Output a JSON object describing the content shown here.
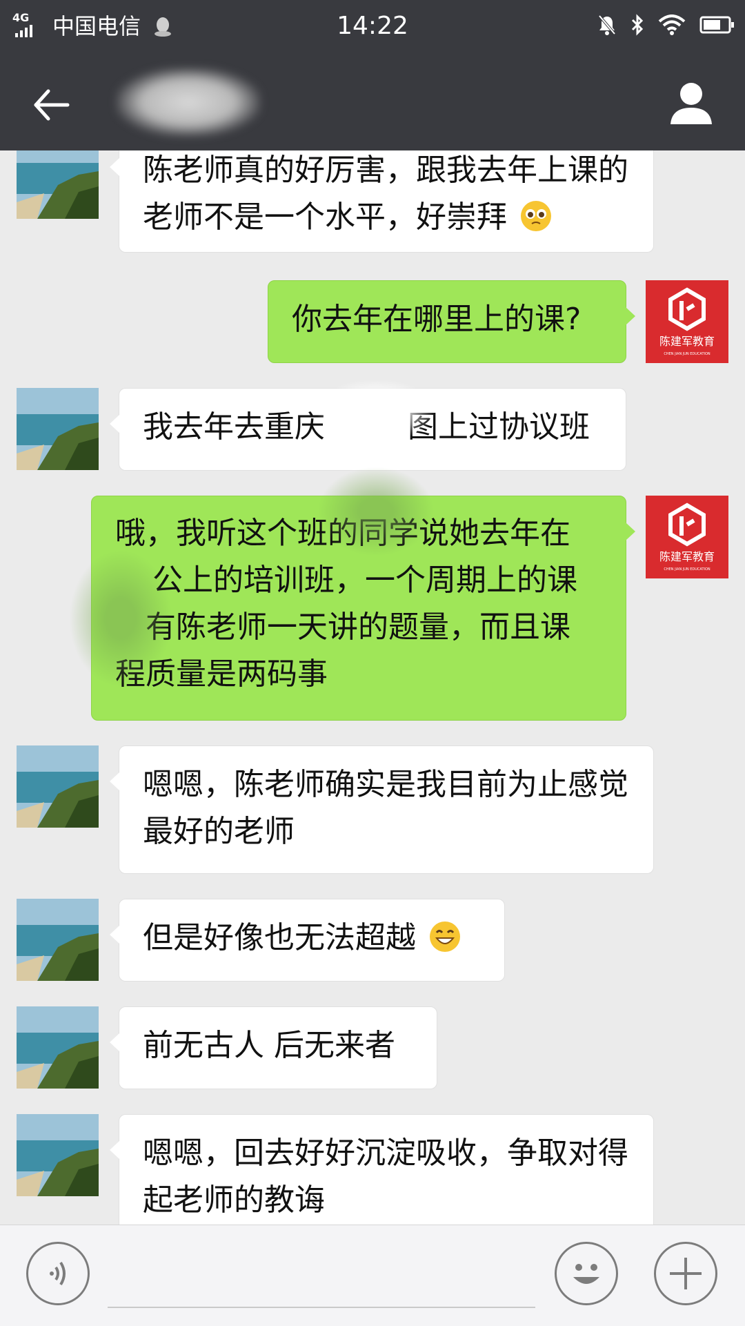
{
  "status_bar": {
    "network": "4G",
    "carrier": "中国电信",
    "time": "14:22"
  },
  "colors": {
    "bar_bg": "#393a3f",
    "chat_bg": "#ebebeb",
    "outgoing_bubble": "#9fe658",
    "incoming_bubble": "#ffffff",
    "brand_red": "#d92b2e"
  },
  "brand": {
    "name": "陈建军教育",
    "subtitle": "CHEN JIAN JUN EDUCATION"
  },
  "messages": [
    {
      "side": "in",
      "text": "陈老师真的好厉害，跟我去年上课的老师不是一个水平，好崇拜",
      "emoji": "pleading-face-icon"
    },
    {
      "side": "out",
      "text": "你去年在哪里上的课?"
    },
    {
      "side": "in",
      "text": "我去年去重庆",
      "text_after_redaction": "图上过协议班"
    },
    {
      "side": "out",
      "text": "哦，我听这个班的同学说她去年在",
      "lines": [
        "公上的培训班，一个周期上的课",
        "有陈老师一天讲的题量，而且课",
        "程质量是两码事"
      ]
    },
    {
      "side": "in",
      "text": "嗯嗯，陈老师确实是我目前为止感觉最好的老师"
    },
    {
      "side": "in",
      "text": "但是好像也无法超越",
      "emoji": "grinning-face-icon"
    },
    {
      "side": "in",
      "text": "前无古人 后无来者"
    },
    {
      "side": "in",
      "text": "嗯嗯，回去好好沉淀吸收，争取对得起老师的教诲"
    }
  ]
}
